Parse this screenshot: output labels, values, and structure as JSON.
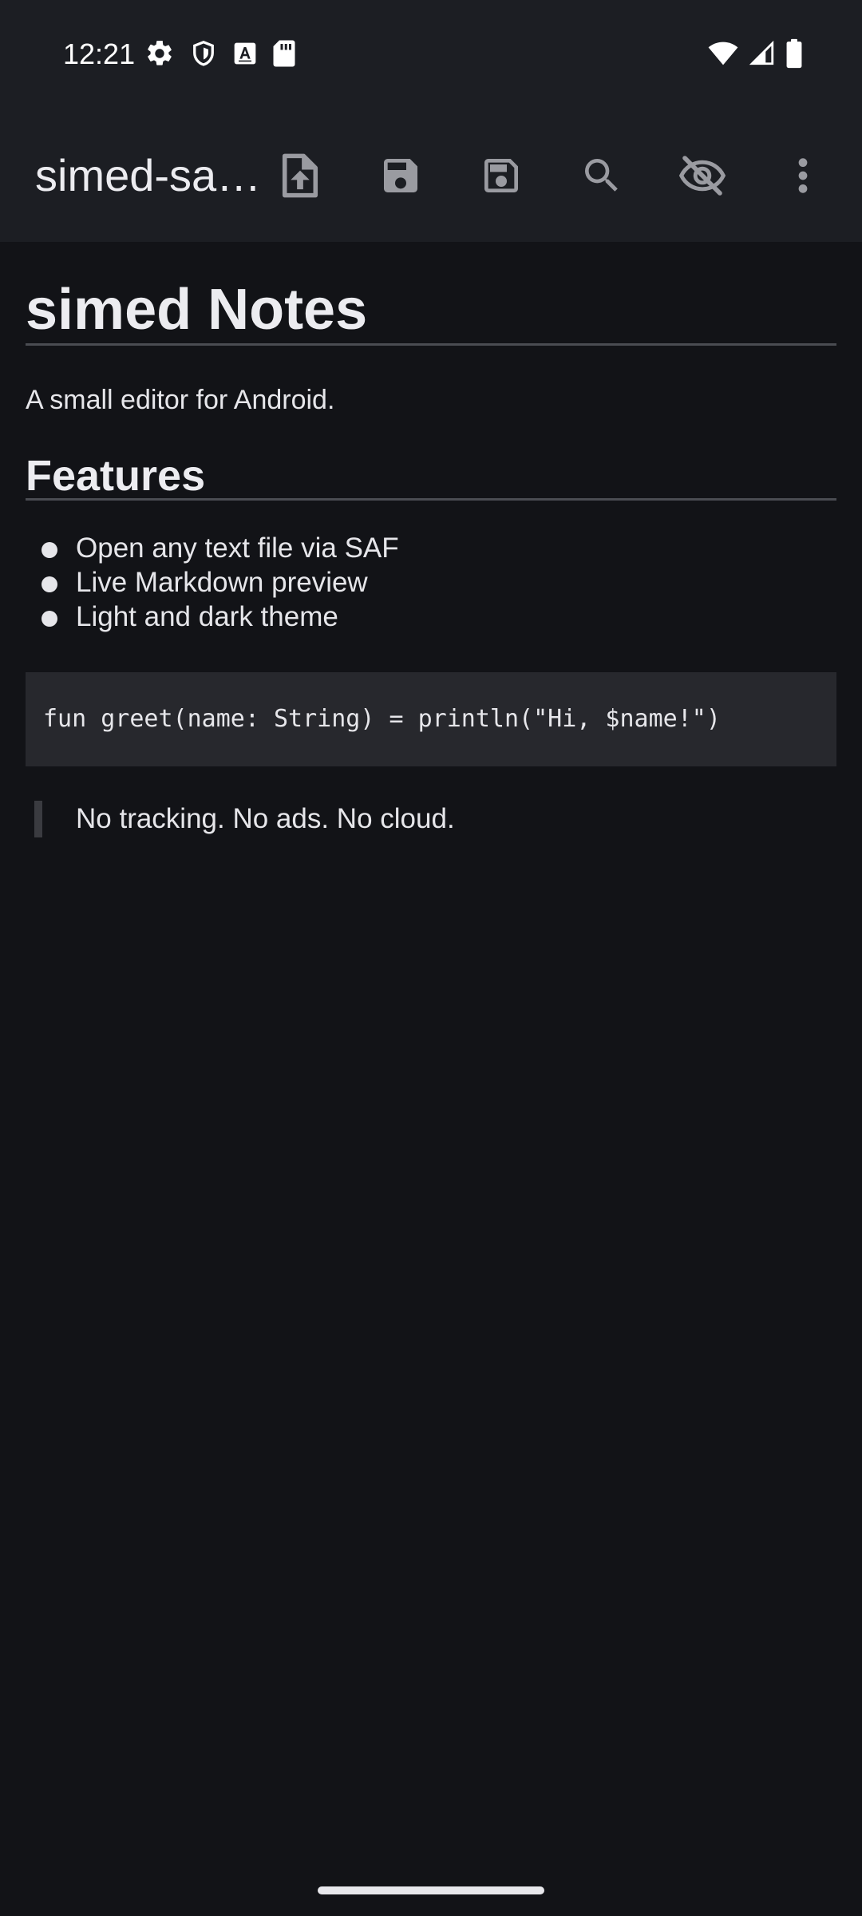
{
  "status_bar": {
    "time": "12:21",
    "left_icons": [
      "settings-icon",
      "shield-icon",
      "text-a-icon",
      "sd-card-icon"
    ],
    "right_icons": [
      "wifi-icon",
      "cell-signal-icon",
      "battery-icon"
    ]
  },
  "toolbar": {
    "title": "simed-sa…",
    "actions": [
      {
        "name": "open-file-button",
        "icon": "file-upload-icon"
      },
      {
        "name": "save-button",
        "icon": "save-icon"
      },
      {
        "name": "save-as-button",
        "icon": "save-outline-icon"
      },
      {
        "name": "search-button",
        "icon": "search-icon"
      },
      {
        "name": "toggle-preview-button",
        "icon": "eye-off-icon"
      },
      {
        "name": "more-options-button",
        "icon": "more-vert-icon"
      }
    ]
  },
  "document": {
    "heading": "simed Notes",
    "paragraph": "A small editor for Android.",
    "subheading": "Features",
    "features": [
      "Open any text file via SAF",
      "Live Markdown preview",
      "Light and dark theme"
    ],
    "code": "fun greet(name: String) = println(\"Hi, $name!\")",
    "quote": "No tracking. No ads. No cloud."
  },
  "colors": {
    "background": "#121317",
    "toolbar": "#1c1e23",
    "text": "#e6e6ea",
    "code_background": "#27282d",
    "rule": "#4a4c52"
  }
}
